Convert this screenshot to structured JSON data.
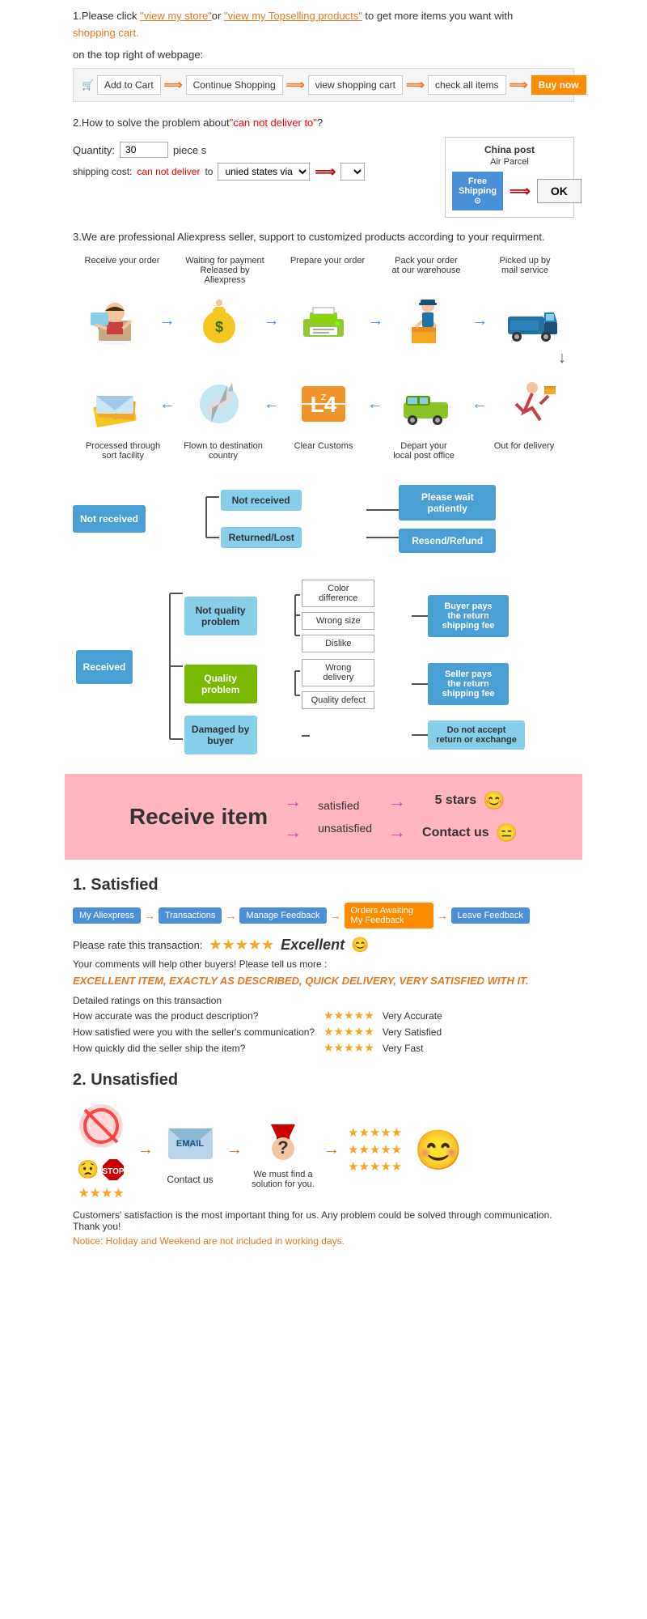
{
  "section1": {
    "text1": "1.Please click ",
    "link1": "\"view my store\"",
    "or_text": "or ",
    "link2": "\"view my Topselling products\"",
    "text2": " to get more items you want with",
    "shopping_cart": "shopping cart.",
    "on_top": "on the top right of webpage:",
    "steps": [
      "Add to Cart",
      "Continue Shopping",
      "view shopping cart",
      "check all items",
      "Buy now"
    ]
  },
  "section2": {
    "title": "2.How to solve the problem about",
    "cant_deliver": "\"can not deliver to\"",
    "question": "?",
    "quantity_label": "Quantity:",
    "quantity_value": "30",
    "piece_label": "piece s",
    "shipping_label": "shipping cost:",
    "cant_deliver2": "can not deliver",
    "to_text": " to ",
    "unied_states": "unied states via",
    "china_post_title": "China post",
    "air_parcel": "Air Parcel",
    "free_shipping": "Free Shipping",
    "ok_label": "OK"
  },
  "section3": {
    "text": "3.We are professional Aliexpress seller, support to customized products according to your requirment."
  },
  "process": {
    "top_labels": [
      "Receive your order",
      "Waiting for payment Released by Aliexpress",
      "Prepare your order",
      "Pack your order at our warehouse",
      "Picked up by mail service"
    ],
    "top_icons": [
      "🧑‍💻",
      "💰",
      "🖨️",
      "👷",
      "🚛"
    ],
    "bottom_labels": [
      "Out for delivery",
      "Depart your local post office",
      "Clear Customs",
      "Flown to destination country",
      "Processed through sort facility"
    ],
    "bottom_icons": [
      "🏃",
      "🚐",
      "📦",
      "✈️",
      "📬"
    ]
  },
  "not_received": {
    "main": "Not received",
    "branch1": "Not received",
    "branch1_outcome": "Please wait patiently",
    "branch2": "Returned/Lost",
    "branch2_outcome": "Resend/Refund"
  },
  "received": {
    "main": "Received",
    "nqp": "Not quality problem",
    "color_diff": "Color difference",
    "wrong_size": "Wrong size",
    "dislike": "Dislike",
    "buyer_pays": "Buyer pays the return shipping fee",
    "qp": "Quality problem",
    "wrong_delivery": "Wrong delivery",
    "quality_defect": "Quality defect",
    "seller_pays": "Seller pays the return shipping fee",
    "damaged": "Damaged by buyer",
    "no_return": "Do not accept return or exchange"
  },
  "pink_section": {
    "receive_item": "Receive item",
    "arrow": "→",
    "satisfied": "satisfied",
    "unsatisfied": "unsatisfied",
    "five_stars": "5 stars",
    "contact_us": "Contact us",
    "smiley_happy": "😊",
    "smiley_neutral": "😑"
  },
  "satisfied": {
    "title": "1. Satisfied",
    "steps": [
      "My Aliexpress",
      "Transactions",
      "Manage Feedback",
      "Orders Awaiting My Feedback",
      "Leave Feedback"
    ],
    "rate_text": "Please rate this transaction:",
    "excellent": "Excellent",
    "smiley": "😊",
    "comments": "Your comments will help other buyers! Please tell us more :",
    "excellent_item": "EXCELLENT ITEM, EXACTLY AS DESCRIBED, QUICK DELIVERY, VERY SATISFIED WITH IT.",
    "detailed_label": "Detailed ratings on this transaction",
    "row1_label": "How accurate was the product description?",
    "row1_value": "Very Accurate",
    "row2_label": "How satisfied were you with the seller's communication?",
    "row2_value": "Very Satisfied",
    "row3_label": "How quickly did the seller ship the item?",
    "row3_value": "Very Fast"
  },
  "unsatisfied": {
    "title": "2. Unsatisfied",
    "contact_us": "Contact us",
    "solution_text": "We must find a solution for you.",
    "footer": "Customers' satisfaction is the most important thing for us. Any problem could be solved through communication. Thank you!",
    "notice": "Notice: Holiday and Weekend are not included in working days."
  }
}
